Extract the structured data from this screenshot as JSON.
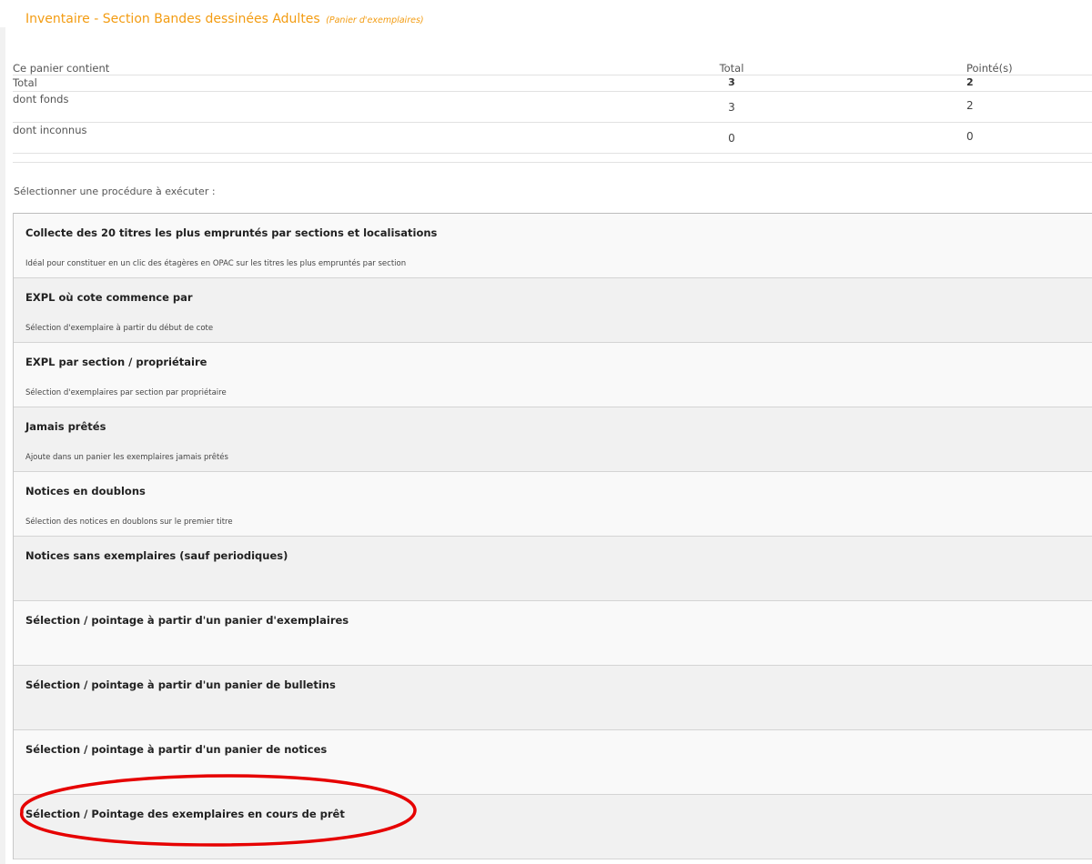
{
  "page": {
    "title": "Inventaire - Section Bandes dessinées Adultes",
    "subtitle": "(Panier d'exemplaires)"
  },
  "stats": {
    "header": {
      "label": "Ce panier contient",
      "total": "Total",
      "checked": "Pointé(s)"
    },
    "rows": [
      {
        "label": "Total",
        "total": "3",
        "checked": "2"
      },
      {
        "label": "dont fonds",
        "total": "3",
        "checked": "2"
      },
      {
        "label": "dont inconnus",
        "total": "0",
        "checked": "0"
      }
    ]
  },
  "procedures": {
    "prompt": "Sélectionner une procédure à exécuter :",
    "items": [
      {
        "name": "Collecte des 20 titres les plus empruntés par sections et localisations",
        "desc": "Idéal pour constituer en un clic des étagères en OPAC sur les titres les plus empruntés par section"
      },
      {
        "name": "EXPL où cote commence par",
        "desc": "Sélection d'exemplaire à partir du début de cote"
      },
      {
        "name": "EXPL par section / propriétaire",
        "desc": "Sélection d'exemplaires par section par propriétaire"
      },
      {
        "name": "Jamais prêtés",
        "desc": "Ajoute dans un panier les exemplaires jamais prêtés"
      },
      {
        "name": "Notices en doublons",
        "desc": "Sélection des notices en doublons sur le premier titre"
      },
      {
        "name": "Notices sans exemplaires (sauf periodiques)",
        "desc": ""
      },
      {
        "name": "Sélection / pointage à partir d'un panier d'exemplaires",
        "desc": ""
      },
      {
        "name": "Sélection / pointage à partir d'un panier de bulletins",
        "desc": ""
      },
      {
        "name": "Sélection / pointage à partir d'un panier de notices",
        "desc": ""
      },
      {
        "name": "Sélection / Pointage des exemplaires en cours de prêt",
        "desc": ""
      }
    ]
  },
  "colors": {
    "title": "#f39c12",
    "highlight": "#e60000",
    "row_odd": "#f9f9f9",
    "row_even": "#f1f1f1"
  }
}
